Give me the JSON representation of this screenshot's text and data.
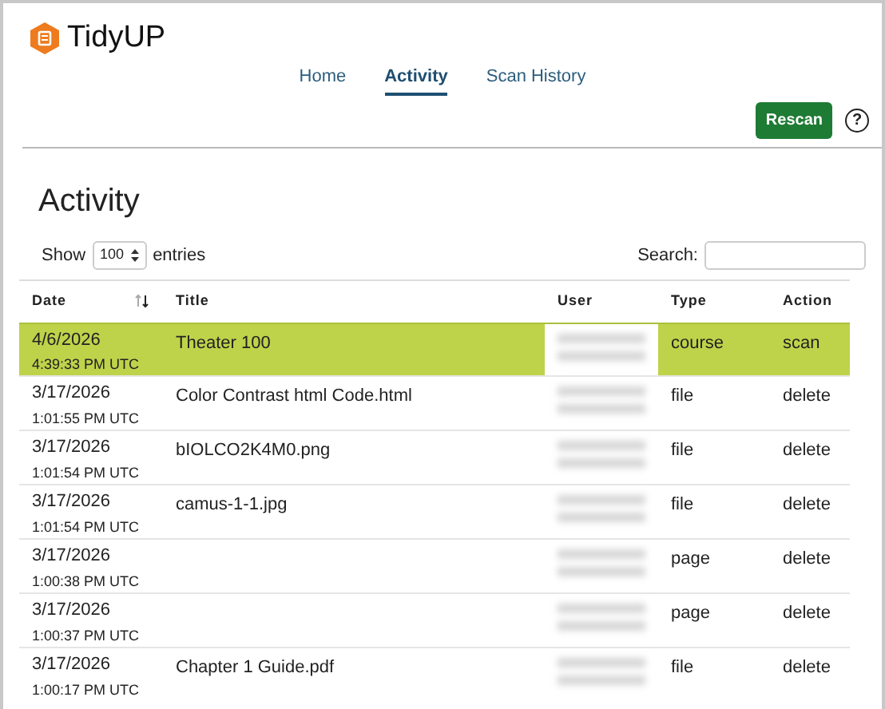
{
  "app": {
    "name": "TidyUP"
  },
  "nav": [
    {
      "label": "Home",
      "selected": false
    },
    {
      "label": "Activity",
      "selected": true
    },
    {
      "label": "Scan History",
      "selected": false
    }
  ],
  "rescan_button": "Rescan",
  "help_icon": "?",
  "heading": "Activity",
  "length_control": {
    "prefix": "Show",
    "value": "100",
    "suffix": "entries"
  },
  "search": {
    "label": "Search:"
  },
  "table": {
    "columns": [
      {
        "label": "Date",
        "sortable": true
      },
      {
        "label": "Title",
        "sortable": false
      },
      {
        "label": "User",
        "sortable": false
      },
      {
        "label": "Type",
        "sortable": false
      },
      {
        "label": "Action",
        "sortable": false
      }
    ],
    "rows": [
      {
        "date": "4/6/2026",
        "time": "4:39:33 PM UTC",
        "title": "Theater 100",
        "user_blurred": true,
        "type": "course",
        "action": "scan",
        "selected": true
      },
      {
        "date": "3/17/2026",
        "time": "1:01:55 PM UTC",
        "title": "Color Contrast html Code.html",
        "user_blurred": true,
        "type": "file",
        "action": "delete",
        "selected": false
      },
      {
        "date": "3/17/2026",
        "time": "1:01:54 PM UTC",
        "title": "bIOLCO2K4M0.png",
        "user_blurred": true,
        "type": "file",
        "action": "delete",
        "selected": false
      },
      {
        "date": "3/17/2026",
        "time": "1:01:54 PM UTC",
        "title": "camus-1-1.jpg",
        "user_blurred": true,
        "type": "file",
        "action": "delete",
        "selected": false
      },
      {
        "date": "3/17/2026",
        "time": "1:00:38 PM UTC",
        "title": "",
        "user_blurred": true,
        "type": "page",
        "action": "delete",
        "selected": false
      },
      {
        "date": "3/17/2026",
        "time": "1:00:37 PM UTC",
        "title": "",
        "user_blurred": true,
        "type": "page",
        "action": "delete",
        "selected": false
      },
      {
        "date": "3/17/2026",
        "time": "1:00:17 PM UTC",
        "title": "Chapter 1 Guide.pdf",
        "user_blurred": true,
        "type": "file",
        "action": "delete",
        "selected": false
      }
    ]
  }
}
